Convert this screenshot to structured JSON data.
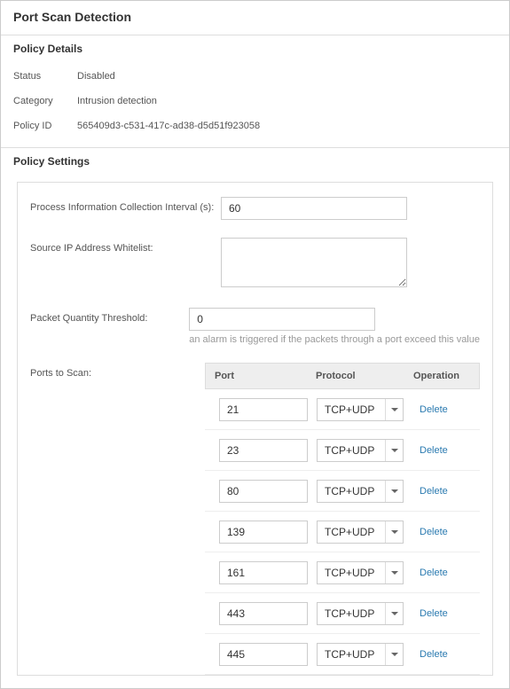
{
  "page_title": "Port Scan Detection",
  "details": {
    "header": "Policy Details",
    "rows": [
      {
        "label": "Status",
        "value": "Disabled"
      },
      {
        "label": "Category",
        "value": "Intrusion detection"
      },
      {
        "label": "Policy ID",
        "value": "565409d3-c531-417c-ad38-d5d51f923058"
      }
    ]
  },
  "settings": {
    "header": "Policy Settings",
    "interval_label": "Process Information Collection Interval (s):",
    "interval_value": "60",
    "whitelist_label": "Source IP Address Whitelist:",
    "whitelist_value": "",
    "threshold_label": "Packet Quantity Threshold:",
    "threshold_value": "0",
    "threshold_hint": "an alarm is triggered if the packets through a port exceed this value",
    "ports_label": "Ports to Scan:",
    "columns": {
      "port": "Port",
      "protocol": "Protocol",
      "operation": "Operation"
    },
    "delete_label": "Delete",
    "rows": [
      {
        "port": "21",
        "protocol": "TCP+UDP"
      },
      {
        "port": "23",
        "protocol": "TCP+UDP"
      },
      {
        "port": "80",
        "protocol": "TCP+UDP"
      },
      {
        "port": "139",
        "protocol": "TCP+UDP"
      },
      {
        "port": "161",
        "protocol": "TCP+UDP"
      },
      {
        "port": "443",
        "protocol": "TCP+UDP"
      },
      {
        "port": "445",
        "protocol": "TCP+UDP"
      }
    ]
  }
}
